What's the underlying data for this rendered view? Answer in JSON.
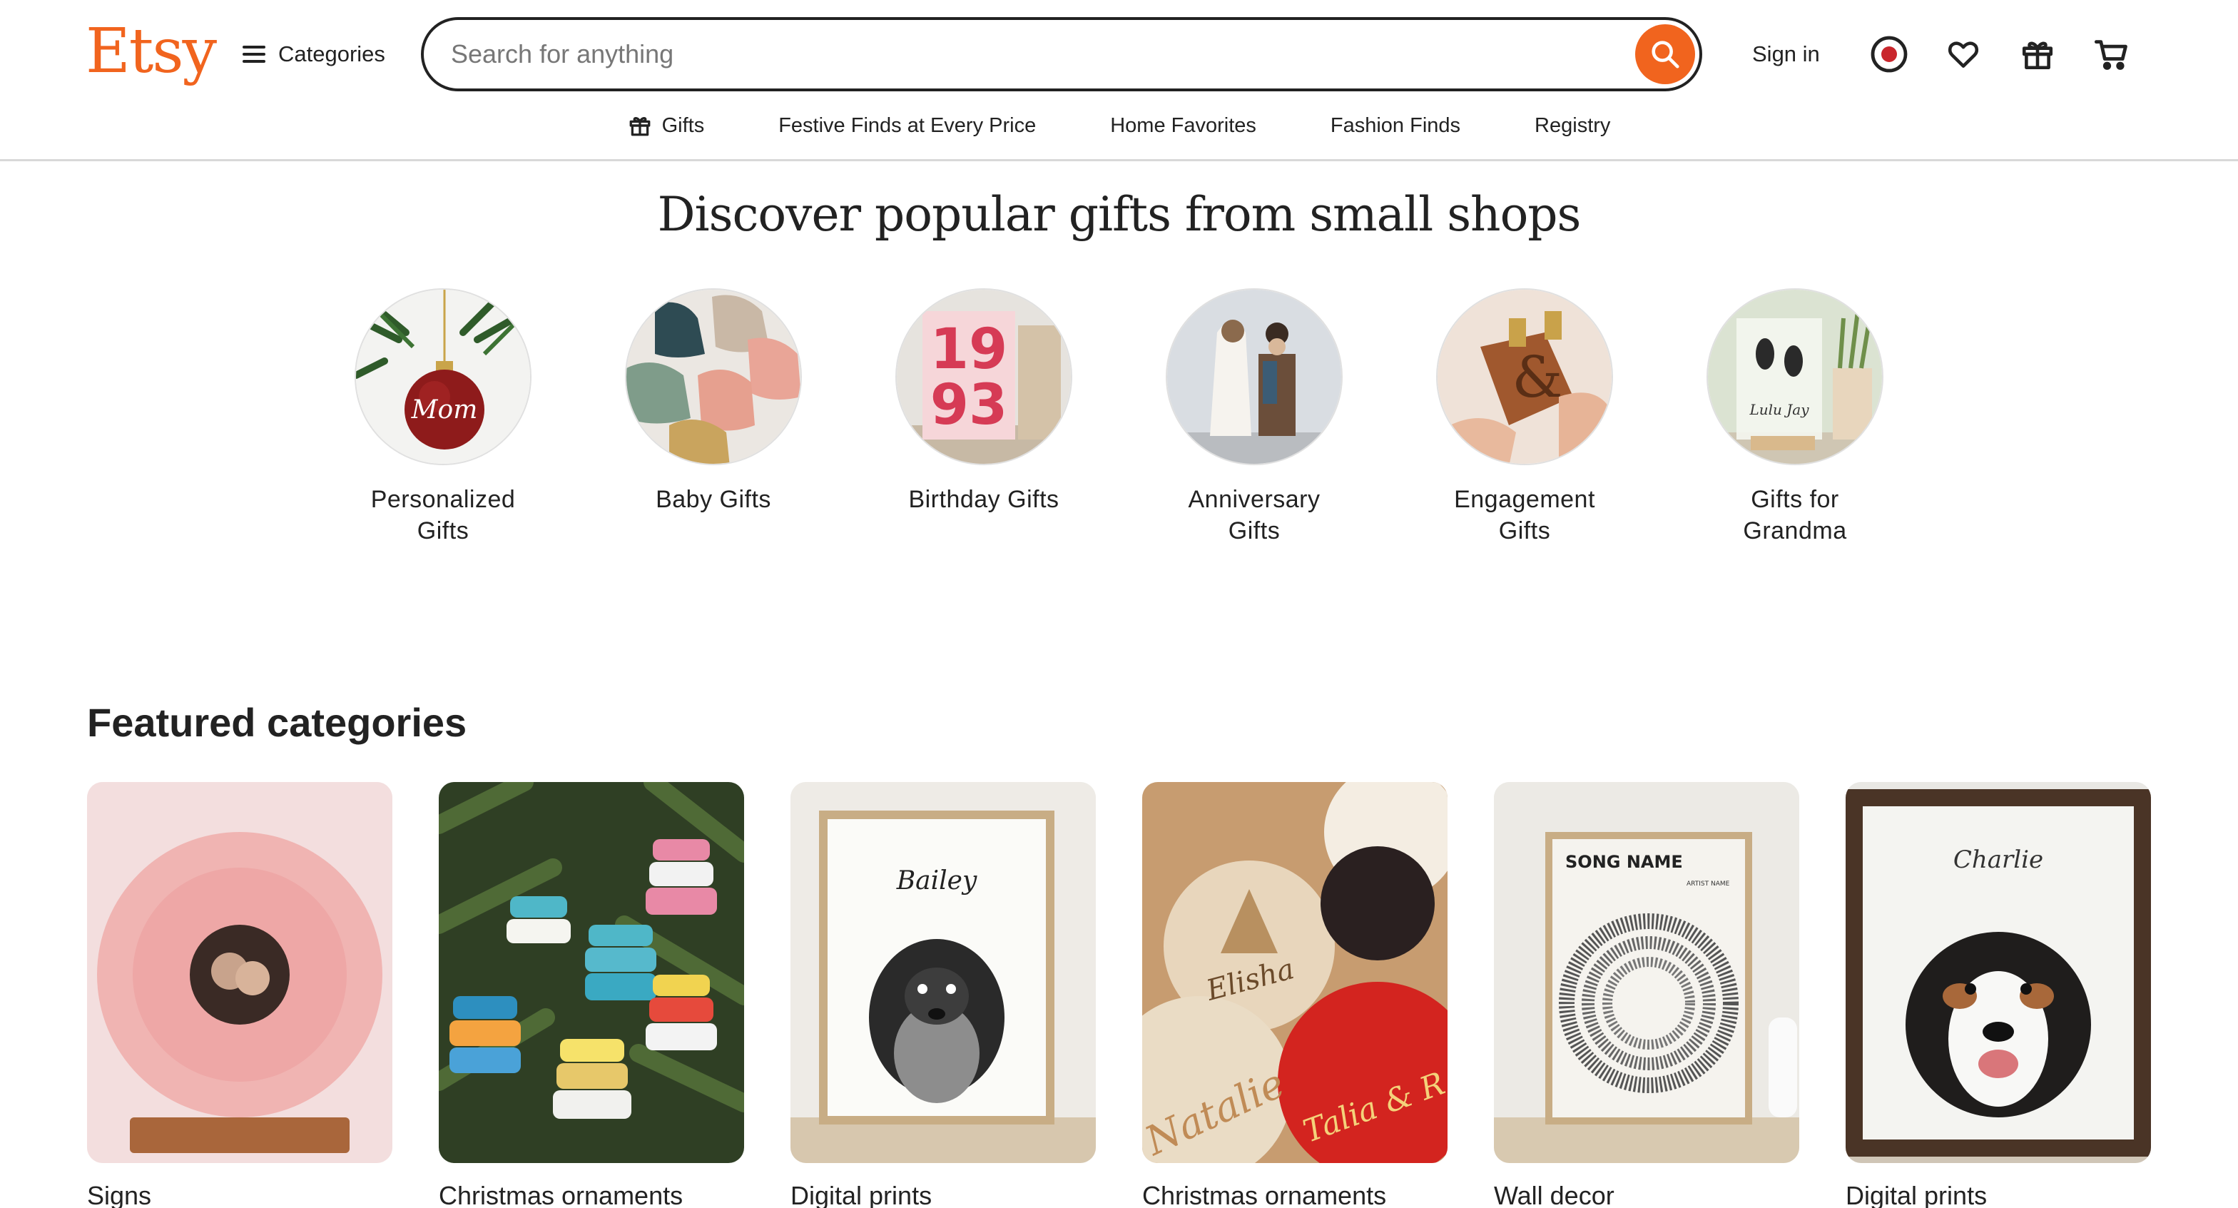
{
  "header": {
    "logo": "Etsy",
    "categories_label": "Categories",
    "search_placeholder": "Search for anything",
    "signin_label": "Sign in",
    "icons": [
      "search-icon",
      "gift-mode-icon",
      "heart-icon",
      "gift-box-icon",
      "cart-icon"
    ]
  },
  "subnav": {
    "items": [
      {
        "label": "Gifts",
        "icon": "gift-icon"
      },
      {
        "label": "Festive Finds at Every Price"
      },
      {
        "label": "Home Favorites"
      },
      {
        "label": "Fashion Finds"
      },
      {
        "label": "Registry"
      }
    ]
  },
  "discover": {
    "title": "Discover popular gifts from small shops",
    "items": [
      {
        "line1": "Personalized",
        "line2": "Gifts"
      },
      {
        "line1": "Baby Gifts",
        "line2": ""
      },
      {
        "line1": "Birthday Gifts",
        "line2": ""
      },
      {
        "line1": "Anniversary",
        "line2": "Gifts"
      },
      {
        "line1": "Engagement",
        "line2": "Gifts"
      },
      {
        "line1": "Gifts for",
        "line2": "Grandma"
      }
    ],
    "image_text": {
      "ornament": "Mom",
      "poster_top": "19",
      "poster_bottom": "93",
      "footprint": "Lulu Jay"
    }
  },
  "featured": {
    "title": "Featured categories",
    "cards": [
      {
        "label": "Signs"
      },
      {
        "label": "Christmas ornaments"
      },
      {
        "label": "Digital prints"
      },
      {
        "label": "Christmas ornaments"
      },
      {
        "label": "Wall decor"
      },
      {
        "label": "Digital prints"
      }
    ],
    "image_text": {
      "print_name": "Bailey",
      "ornament_names": [
        "Elisha",
        "Natalie",
        "Talia & R"
      ],
      "song_title": "SONG NAME",
      "song_artist": "ARTIST NAME",
      "portrait_name": "Charlie"
    }
  },
  "colors": {
    "brand": "#f1641e",
    "text": "#222222",
    "border": "#d8d8d8"
  }
}
